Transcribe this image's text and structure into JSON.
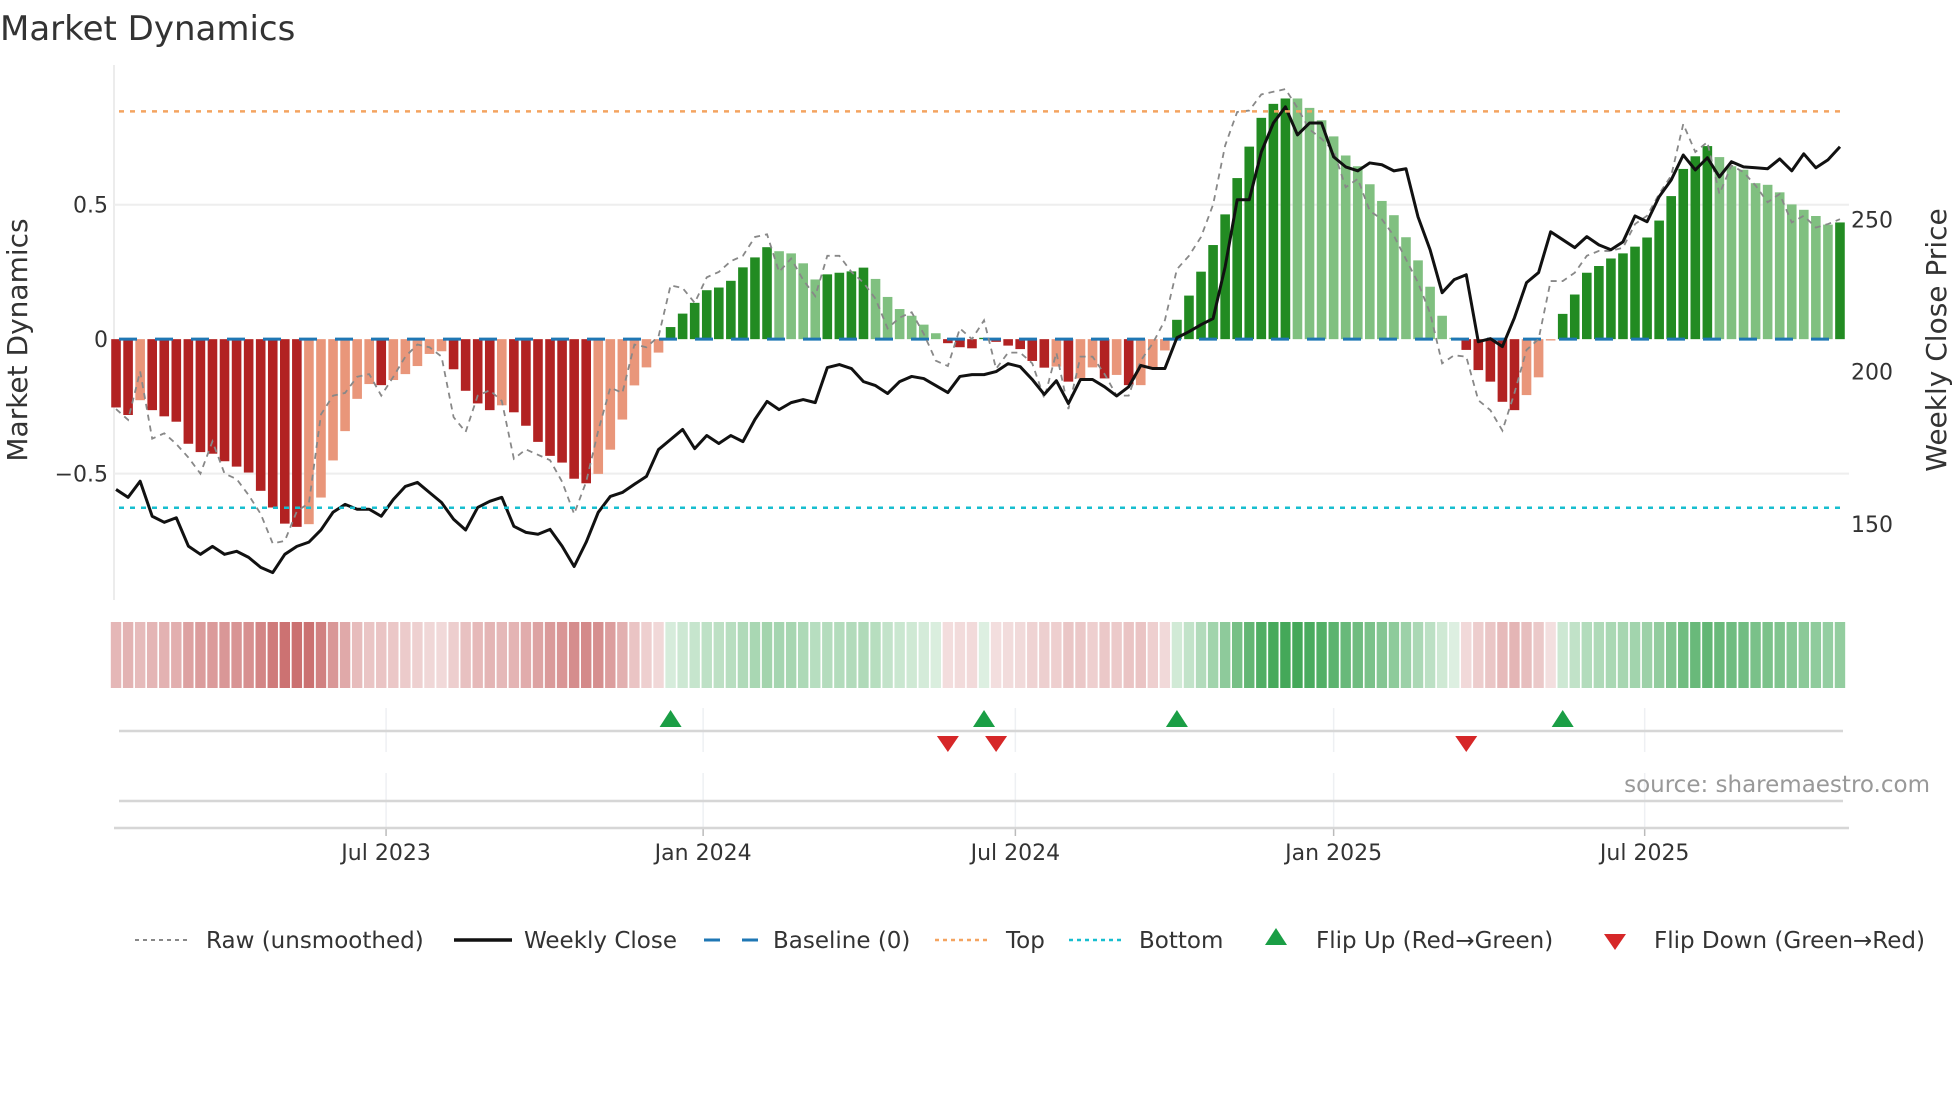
{
  "chart_data": {
    "type": "bar",
    "title": "Market Dynamics",
    "ylabel": "Market Dynamics",
    "y2label": "Weekly Close Price",
    "ylim": [
      -0.97,
      0.96
    ],
    "y2lim": [
      125,
      295.4
    ],
    "yticks": [
      {
        "v": 0.5,
        "label": "0.5"
      },
      {
        "v": 0,
        "label": "0"
      },
      {
        "v": -0.5,
        "label": "−0.5"
      }
    ],
    "y2ticks": [
      {
        "v": 250,
        "label": "250"
      },
      {
        "v": 200,
        "label": "200"
      },
      {
        "v": 150,
        "label": "150"
      }
    ],
    "x_unit": "week index",
    "xlim": [
      -0.5,
      143.5
    ],
    "xticks": [
      {
        "v": 22.4,
        "label": "Jul 2023"
      },
      {
        "v": 48.7,
        "label": "Jan 2024"
      },
      {
        "v": 74.6,
        "label": "Jul 2024"
      },
      {
        "v": 101.0,
        "label": "Jan 2025"
      },
      {
        "v": 126.8,
        "label": "Jul 2025"
      }
    ],
    "top_level": 0.847,
    "bottom_level": -0.627,
    "baseline": 0,
    "momentum": [
      -0.254,
      -0.282,
      -0.227,
      -0.264,
      -0.287,
      -0.307,
      -0.389,
      -0.42,
      -0.426,
      -0.454,
      -0.474,
      -0.496,
      -0.564,
      -0.626,
      -0.686,
      -0.698,
      -0.688,
      -0.589,
      -0.451,
      -0.342,
      -0.222,
      -0.167,
      -0.171,
      -0.152,
      -0.13,
      -0.1,
      -0.055,
      -0.045,
      -0.112,
      -0.192,
      -0.239,
      -0.264,
      -0.246,
      -0.272,
      -0.322,
      -0.382,
      -0.434,
      -0.459,
      -0.519,
      -0.536,
      -0.501,
      -0.411,
      -0.299,
      -0.172,
      -0.105,
      -0.05,
      0.045,
      0.095,
      0.135,
      0.182,
      0.192,
      0.217,
      0.267,
      0.304,
      0.342,
      0.327,
      0.319,
      0.282,
      0.222,
      0.241,
      0.247,
      0.252,
      0.266,
      0.224,
      0.157,
      0.112,
      0.087,
      0.054,
      0.022,
      -0.015,
      -0.03,
      -0.034,
      0.005,
      -0.01,
      -0.024,
      -0.037,
      -0.081,
      -0.106,
      -0.102,
      -0.158,
      -0.146,
      -0.105,
      -0.146,
      -0.133,
      -0.171,
      -0.171,
      -0.105,
      -0.042,
      0.072,
      0.162,
      0.251,
      0.35,
      0.464,
      0.599,
      0.716,
      0.823,
      0.875,
      0.895,
      0.895,
      0.86,
      0.814,
      0.754,
      0.683,
      0.643,
      0.576,
      0.514,
      0.461,
      0.379,
      0.293,
      0.195,
      0.087,
      0.005,
      -0.04,
      -0.115,
      -0.158,
      -0.233,
      -0.264,
      -0.208,
      -0.142,
      -0.005,
      0.094,
      0.166,
      0.247,
      0.272,
      0.3,
      0.319,
      0.344,
      0.378,
      0.441,
      0.532,
      0.633,
      0.68,
      0.718,
      0.677,
      0.643,
      0.63,
      0.58,
      0.574,
      0.546,
      0.501,
      0.481,
      0.458,
      0.426,
      0.434
    ],
    "raw": [
      -0.26,
      -0.3,
      -0.12,
      -0.37,
      -0.35,
      -0.39,
      -0.44,
      -0.5,
      -0.38,
      -0.5,
      -0.52,
      -0.58,
      -0.65,
      -0.76,
      -0.75,
      -0.64,
      -0.61,
      -0.28,
      -0.21,
      -0.2,
      -0.14,
      -0.13,
      -0.21,
      -0.14,
      -0.065,
      -0.02,
      -0.03,
      -0.065,
      -0.29,
      -0.345,
      -0.21,
      -0.19,
      -0.23,
      -0.445,
      -0.41,
      -0.43,
      -0.45,
      -0.53,
      -0.65,
      -0.53,
      -0.34,
      -0.18,
      -0.2,
      -0.02,
      -0.03,
      0.01,
      0.2,
      0.19,
      0.135,
      0.23,
      0.25,
      0.29,
      0.31,
      0.38,
      0.39,
      0.25,
      0.3,
      0.22,
      0.16,
      0.31,
      0.31,
      0.25,
      0.21,
      0.15,
      0.04,
      0.08,
      0.1,
      0.02,
      -0.08,
      -0.1,
      0.04,
      0.0,
      0.07,
      -0.11,
      -0.05,
      -0.05,
      -0.09,
      -0.22,
      -0.05,
      -0.26,
      -0.065,
      -0.065,
      -0.13,
      -0.21,
      -0.21,
      -0.08,
      -0.015,
      0.07,
      0.26,
      0.31,
      0.38,
      0.5,
      0.72,
      0.845,
      0.85,
      0.91,
      0.92,
      0.93,
      0.86,
      0.78,
      0.745,
      0.7,
      0.565,
      0.596,
      0.477,
      0.446,
      0.384,
      0.297,
      0.21,
      0.097,
      -0.09,
      -0.06,
      -0.065,
      -0.227,
      -0.264,
      -0.34,
      -0.2,
      -0.04,
      0.0,
      0.216,
      0.216,
      0.247,
      0.31,
      0.328,
      0.328,
      0.34,
      0.428,
      0.459,
      0.54,
      0.608,
      0.8,
      0.696,
      0.733,
      0.54,
      0.646,
      0.621,
      0.571,
      0.509,
      0.54,
      0.434,
      0.459,
      0.415,
      0.428,
      0.446
    ],
    "weekly_close": [
      161.3,
      158.7,
      164,
      152.5,
      150.5,
      152,
      142.7,
      140,
      142.6,
      140,
      141,
      139,
      135.7,
      134,
      140,
      142.6,
      144,
      148,
      153.8,
      156.4,
      154.8,
      154.8,
      152.5,
      158,
      162.3,
      163.6,
      160.3,
      157,
      151.5,
      148,
      155.4,
      157.4,
      158.7,
      149.2,
      147.2,
      146.6,
      148.2,
      142.7,
      136,
      144,
      153.8,
      159,
      160.3,
      163,
      165.6,
      174.4,
      177.7,
      181,
      174.7,
      179,
      176.4,
      179,
      177,
      184.3,
      190.2,
      187.5,
      189.8,
      190.8,
      189.8,
      201.3,
      202.3,
      201,
      196.7,
      195.4,
      192.8,
      196.7,
      198.4,
      197.7,
      195.4,
      193.1,
      198.4,
      199,
      199,
      200,
      202.6,
      201.6,
      197.4,
      192.5,
      197,
      189.5,
      197.4,
      197.4,
      195,
      192,
      195,
      202,
      201,
      201,
      211.1,
      213.1,
      215.4,
      217.4,
      234.4,
      256.4,
      256.4,
      272.1,
      281.6,
      286.9,
      277.7,
      281.6,
      281.6,
      270.5,
      267.2,
      265.9,
      268.5,
      267.9,
      265.9,
      266.6,
      250.8,
      240,
      225.9,
      230.2,
      231.8,
      209.8,
      210.8,
      208.2,
      217.7,
      229.2,
      232.5,
      245.9,
      243.3,
      240.7,
      244.3,
      241.6,
      240,
      242.6,
      251.1,
      249.2,
      257.4,
      262.9,
      271.1,
      266.2,
      270.2,
      263.9,
      268.9,
      267.2,
      266.9,
      266.6,
      269.8,
      265.9,
      271.5,
      266.9,
      269.5,
      273.8
    ],
    "flip_up": [
      46,
      72,
      88,
      120
    ],
    "flip_down": [
      69,
      73,
      112
    ],
    "legend": {
      "placement": "bottom",
      "items": [
        "Raw (unsmoothed)",
        "Weekly Close",
        "Baseline (0)",
        "Top",
        "Bottom",
        "Flip Up (Red→Green)",
        "Flip Down (Green→Red)"
      ]
    },
    "source": "source: sharemaestro.com"
  },
  "colors": {
    "pos_strong": "#228b22",
    "pos_weak": "#80c080",
    "neg_strong": "#b22222",
    "neg_weak": "#e9967a",
    "raw": "#888888",
    "close": "#111111",
    "baseline": "#1f77b4",
    "top": "#f4a460",
    "bottom": "#17becf",
    "flip_up": "#1a9e45",
    "flip_down": "#d62728"
  }
}
